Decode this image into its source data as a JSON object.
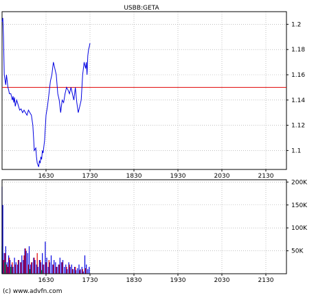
{
  "chart_data": [
    {
      "type": "line",
      "title": "USBB:GETA",
      "xlabel": "",
      "ylabel": "",
      "x_ticks": [
        "1630",
        "1730",
        "1830",
        "1930",
        "2030",
        "2130"
      ],
      "y_ticks": [
        "1.1",
        "1.12",
        "1.14",
        "1.16",
        "1.18",
        "1.2"
      ],
      "ylim": [
        1.085,
        1.21
      ],
      "x_range": [
        "15:30",
        "22:30"
      ],
      "grid": true,
      "reference_line": {
        "value": 1.15,
        "color": "#e00000"
      },
      "series": [
        {
          "color": "#0000e0",
          "x": [
            "15:30",
            "15:31",
            "15:32",
            "15:33",
            "15:35",
            "15:36",
            "15:37",
            "15:38",
            "15:39",
            "15:40",
            "15:42",
            "15:44",
            "15:45",
            "15:46",
            "15:47",
            "15:48",
            "15:50",
            "15:52",
            "15:54",
            "15:56",
            "15:58",
            "16:00",
            "16:02",
            "16:04",
            "16:06",
            "16:08",
            "16:10",
            "16:12",
            "16:13",
            "16:14",
            "16:16",
            "16:17",
            "16:18",
            "16:20",
            "16:21",
            "16:22",
            "16:23",
            "16:24",
            "16:25",
            "16:26",
            "16:28",
            "16:30",
            "16:32",
            "16:34",
            "16:35",
            "16:36",
            "16:38",
            "16:40",
            "16:42",
            "16:44",
            "16:46",
            "16:48",
            "16:50",
            "16:52",
            "16:54",
            "16:56",
            "16:58",
            "17:00",
            "17:02",
            "17:04",
            "17:06",
            "17:08",
            "17:10",
            "17:12",
            "17:14",
            "17:16",
            "17:18",
            "17:20",
            "17:22",
            "17:24",
            "17:25",
            "17:26",
            "17:27",
            "17:28",
            "17:29",
            "17:30"
          ],
          "y": [
            1.202,
            1.205,
            1.19,
            1.16,
            1.152,
            1.16,
            1.155,
            1.15,
            1.148,
            1.145,
            1.145,
            1.14,
            1.143,
            1.138,
            1.142,
            1.135,
            1.14,
            1.136,
            1.132,
            1.133,
            1.13,
            1.132,
            1.13,
            1.128,
            1.132,
            1.13,
            1.128,
            1.12,
            1.11,
            1.1,
            1.102,
            1.095,
            1.09,
            1.087,
            1.092,
            1.09,
            1.095,
            1.093,
            1.1,
            1.098,
            1.108,
            1.128,
            1.135,
            1.145,
            1.15,
            1.155,
            1.16,
            1.17,
            1.165,
            1.16,
            1.145,
            1.14,
            1.13,
            1.14,
            1.138,
            1.145,
            1.15,
            1.148,
            1.145,
            1.15,
            1.145,
            1.14,
            1.15,
            1.138,
            1.13,
            1.135,
            1.14,
            1.16,
            1.17,
            1.165,
            1.17,
            1.16,
            1.175,
            1.18,
            1.182,
            1.185
          ]
        }
      ]
    },
    {
      "type": "bar",
      "title": "",
      "xlabel": "",
      "ylabel": "",
      "x_ticks": [
        "1630",
        "1730",
        "1830",
        "1930",
        "2030",
        "2130"
      ],
      "y_ticks": [
        "50K",
        "100K",
        "150K",
        "200K"
      ],
      "ylim": [
        0,
        205000
      ],
      "x_range": [
        "15:30",
        "22:30"
      ],
      "grid": true,
      "series": [
        {
          "name": "up",
          "color": "#0000e0",
          "x": [
            "15:30",
            "15:31",
            "15:33",
            "15:35",
            "15:37",
            "15:39",
            "15:41",
            "15:43",
            "15:45",
            "15:47",
            "15:49",
            "15:51",
            "15:53",
            "15:55",
            "15:57",
            "15:59",
            "16:01",
            "16:03",
            "16:05",
            "16:07",
            "16:09",
            "16:11",
            "16:13",
            "16:15",
            "16:17",
            "16:19",
            "16:21",
            "16:23",
            "16:25",
            "16:27",
            "16:29",
            "16:31",
            "16:33",
            "16:35",
            "16:37",
            "16:39",
            "16:41",
            "16:43",
            "16:45",
            "16:47",
            "16:49",
            "16:51",
            "16:53",
            "16:55",
            "16:57",
            "16:59",
            "17:01",
            "17:03",
            "17:05",
            "17:07",
            "17:09",
            "17:11",
            "17:13",
            "17:15",
            "17:17",
            "17:19",
            "17:21",
            "17:23",
            "17:25",
            "17:27",
            "17:29"
          ],
          "values": [
            190000,
            150000,
            45000,
            60000,
            25000,
            40000,
            30000,
            20000,
            15000,
            35000,
            25000,
            20000,
            30000,
            25000,
            40000,
            30000,
            55000,
            50000,
            45000,
            60000,
            20000,
            25000,
            35000,
            30000,
            20000,
            15000,
            30000,
            25000,
            45000,
            20000,
            70000,
            35000,
            15000,
            25000,
            40000,
            20000,
            30000,
            25000,
            15000,
            20000,
            35000,
            25000,
            30000,
            15000,
            20000,
            10000,
            25000,
            15000,
            20000,
            10000,
            15000,
            8000,
            12000,
            20000,
            10000,
            15000,
            5000,
            40000,
            20000,
            10000,
            15000
          ]
        },
        {
          "name": "down",
          "color": "#e00000",
          "x": [
            "15:32",
            "15:34",
            "15:36",
            "15:38",
            "15:40",
            "15:44",
            "15:48",
            "15:52",
            "15:56",
            "16:00",
            "16:02",
            "16:06",
            "16:10",
            "16:14",
            "16:18",
            "16:22",
            "16:26",
            "16:30",
            "16:34",
            "16:40",
            "16:44",
            "16:48",
            "16:52",
            "16:58",
            "17:02",
            "17:06",
            "17:10",
            "17:16",
            "17:20",
            "17:24"
          ],
          "values": [
            30000,
            45000,
            20000,
            15000,
            35000,
            25000,
            20000,
            30000,
            25000,
            40000,
            55000,
            20000,
            25000,
            35000,
            45000,
            30000,
            20000,
            25000,
            30000,
            20000,
            15000,
            20000,
            25000,
            15000,
            20000,
            10000,
            15000,
            8000,
            10000,
            12000
          ]
        },
        {
          "name": "neutral",
          "color": "#00a000",
          "x": [
            "15:30",
            "15:34",
            "15:42",
            "16:08",
            "16:24"
          ],
          "values": [
            60000,
            25000,
            15000,
            10000,
            8000
          ]
        }
      ]
    }
  ],
  "watermark": "(c) www.advfn.com"
}
